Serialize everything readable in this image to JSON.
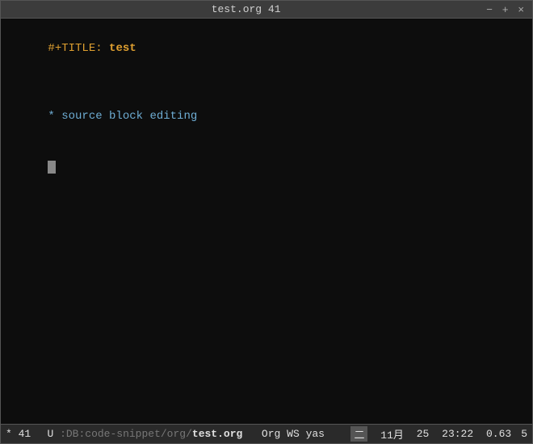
{
  "titlebar": {
    "title": "test.org  41",
    "minimize": "−",
    "maximize": "+",
    "close": "×"
  },
  "editor": {
    "line1_keyword": "#+TITLE: ",
    "line1_value": "test",
    "line2_text": "* source block editing"
  },
  "statusbar": {
    "star": "*",
    "linenum": "41",
    "u_flag": "U",
    "db_path": ":DB:code-snippet/org/",
    "db_filename": "test.org",
    "org_label": "Org",
    "ws_label": "WS",
    "yas_label": "yas",
    "japanese_indicator": "二",
    "month_label": "11月",
    "day": "25",
    "time": "23:22",
    "decimal": "0.63",
    "right_num": "5"
  }
}
